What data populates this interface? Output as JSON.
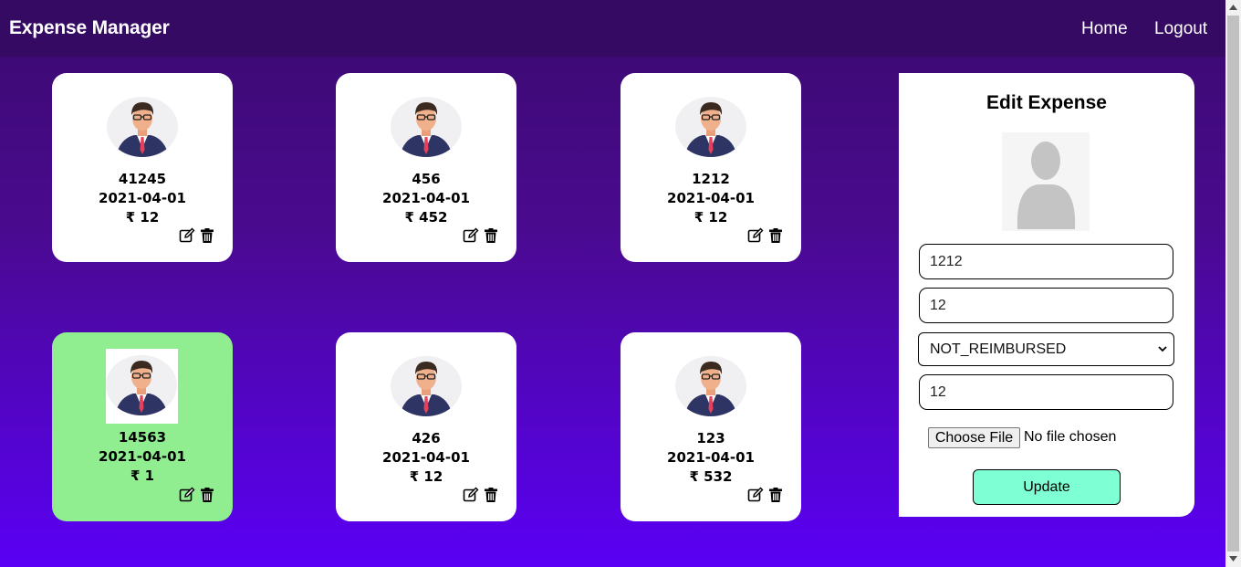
{
  "header": {
    "brand": "Expense Manager",
    "nav": [
      "Home",
      "Logout"
    ]
  },
  "cards": [
    {
      "id": "41245",
      "date": "2021-04-01",
      "amount": "₹ 12",
      "selected": false
    },
    {
      "id": "456",
      "date": "2021-04-01",
      "amount": "₹ 452",
      "selected": false
    },
    {
      "id": "1212",
      "date": "2021-04-01",
      "amount": "₹ 12",
      "selected": false
    },
    {
      "id": "14563",
      "date": "2021-04-01",
      "amount": "₹ 1",
      "selected": true
    },
    {
      "id": "426",
      "date": "2021-04-01",
      "amount": "₹ 12",
      "selected": false
    },
    {
      "id": "123",
      "date": "2021-04-01",
      "amount": "₹ 532",
      "selected": false
    }
  ],
  "edit_panel": {
    "title": "Edit Expense",
    "fields": [
      "1212",
      "12",
      "12"
    ],
    "status_select": "NOT_REIMBURSED",
    "file_button": "Choose File",
    "file_status": "No file chosen",
    "update_label": "Update"
  },
  "icons": {
    "edit": "edit-icon",
    "delete": "trash-icon",
    "avatar": "businessman-avatar-icon",
    "placeholder": "user-placeholder-icon"
  },
  "colors": {
    "selected_card": "#90ee90",
    "update_button": "#7fffd4",
    "navbar": "#340a62"
  }
}
